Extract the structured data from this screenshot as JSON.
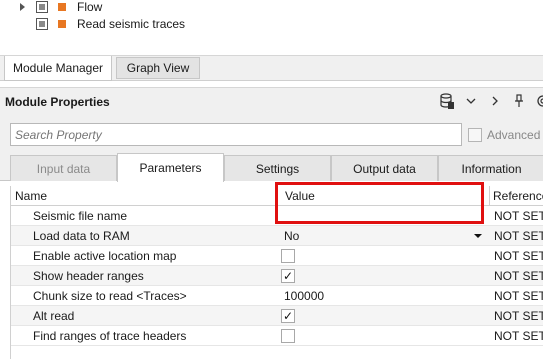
{
  "tree": {
    "items": [
      {
        "label": "Flow",
        "color": "#e87722"
      },
      {
        "label": "Read seismic traces",
        "color": "#e87722"
      }
    ]
  },
  "bottom_tabs": {
    "module_manager": "Module Manager",
    "graph_view": "Graph View"
  },
  "module_properties": {
    "title": "Module Properties",
    "icons": [
      "database-icon",
      "chevron-down-icon",
      "chevron-right-icon",
      "pin-icon",
      "gear-icon"
    ]
  },
  "search": {
    "placeholder": "Search Property",
    "advanced_label": "Advanced"
  },
  "property_tabs": [
    {
      "label": "Input data",
      "state": "disabled"
    },
    {
      "label": "Parameters",
      "state": "selected"
    },
    {
      "label": "Settings",
      "state": "normal"
    },
    {
      "label": "Output data",
      "state": "normal"
    },
    {
      "label": "Information",
      "state": "normal"
    }
  ],
  "grid": {
    "headers": {
      "name": "Name",
      "value": "Value",
      "reference": "Reference"
    },
    "rows": [
      {
        "name": "Seismic file name",
        "value": "",
        "type": "text",
        "reference": "NOT SET"
      },
      {
        "name": "Load data to RAM",
        "value": "No",
        "type": "dropdown",
        "reference": "NOT SET"
      },
      {
        "name": "Enable active location map",
        "value": false,
        "type": "checkbox",
        "reference": "NOT SET"
      },
      {
        "name": "Show header ranges",
        "value": true,
        "type": "checkbox",
        "reference": "NOT SET"
      },
      {
        "name": "Chunk size to read <Traces>",
        "value": "100000",
        "type": "text",
        "reference": "NOT SET"
      },
      {
        "name": "Alt read",
        "value": true,
        "type": "checkbox",
        "reference": "NOT SET"
      },
      {
        "name": "Find ranges of trace headers",
        "value": false,
        "type": "checkbox",
        "reference": "NOT SET"
      }
    ],
    "check_glyph": "✓"
  },
  "colors": {
    "highlight": "#e01010",
    "accent_orange": "#e87722"
  }
}
